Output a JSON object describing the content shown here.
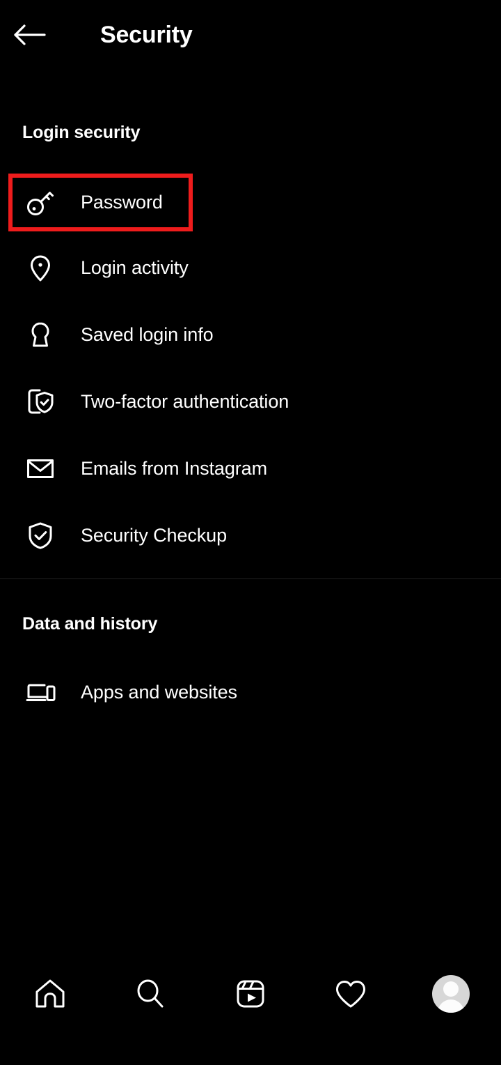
{
  "header": {
    "back_icon": "back-arrow-icon",
    "title": "Security"
  },
  "sections": [
    {
      "id": "login-security",
      "title": "Login security",
      "items": [
        {
          "label": "Password",
          "icon": "key-icon",
          "highlighted": true
        },
        {
          "label": "Login activity",
          "icon": "location-pin-icon"
        },
        {
          "label": "Saved login info",
          "icon": "keyhole-icon"
        },
        {
          "label": "Two-factor authentication",
          "icon": "phone-shield-check-icon"
        },
        {
          "label": "Emails from Instagram",
          "icon": "envelope-icon"
        },
        {
          "label": "Security Checkup",
          "icon": "shield-check-icon"
        }
      ]
    },
    {
      "id": "data-history",
      "title": "Data and history",
      "items": [
        {
          "label": "Apps and websites",
          "icon": "laptop-phone-icon"
        }
      ]
    }
  ],
  "bottom_nav": [
    {
      "name": "home-icon",
      "label": "Home"
    },
    {
      "name": "search-icon",
      "label": "Search"
    },
    {
      "name": "reels-icon",
      "label": "Reels"
    },
    {
      "name": "heart-icon",
      "label": "Activity"
    },
    {
      "name": "profile-avatar",
      "label": "Profile"
    }
  ],
  "colors": {
    "background": "#000000",
    "text": "#ffffff",
    "highlight": "#ee1c1c",
    "divider": "#232323",
    "avatar": "#d7d7d7"
  }
}
